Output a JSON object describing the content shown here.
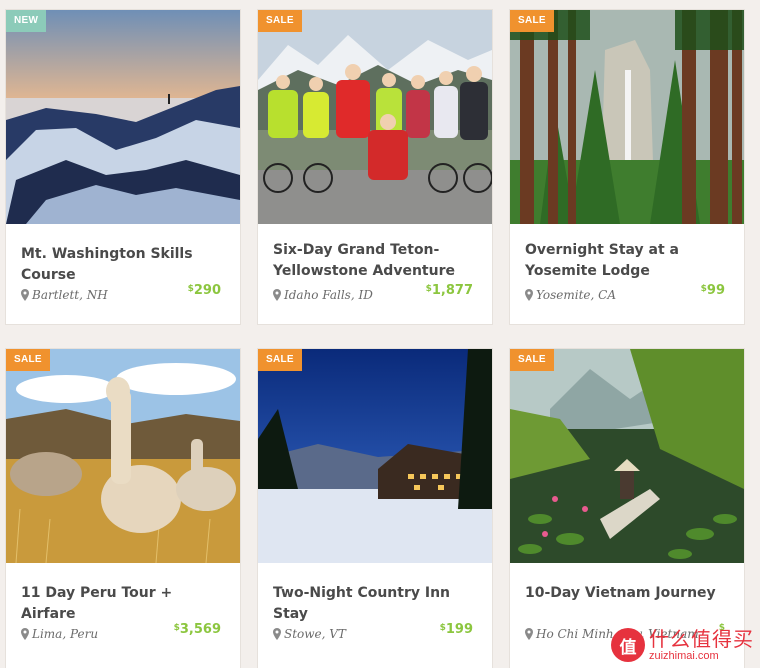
{
  "cards": [
    {
      "badge": "NEW",
      "title": "Mt. Washington Skills Course",
      "location": "Bartlett, NH",
      "currency": "$",
      "price": "290"
    },
    {
      "badge": "SALE",
      "title": "Six-Day Grand Teton-Yellowstone Adventure",
      "location": "Idaho Falls, ID",
      "currency": "$",
      "price": "1,877"
    },
    {
      "badge": "SALE",
      "title": "Overnight Stay at a Yosemite Lodge",
      "location": "Yosemite, CA",
      "currency": "$",
      "price": "99"
    },
    {
      "badge": "SALE",
      "title": "11 Day Peru Tour + Airfare",
      "location": "Lima, Peru",
      "currency": "$",
      "price": "3,569"
    },
    {
      "badge": "SALE",
      "title": "Two-Night Country Inn Stay",
      "location": "Stowe, VT",
      "currency": "$",
      "price": "199"
    },
    {
      "badge": "SALE",
      "title": "10-Day Vietnam Journey",
      "location": "Ho Chi Minh City, Vietnam",
      "currency": "$",
      "price": ""
    }
  ],
  "watermark": {
    "logo_char": "值",
    "text_cn": "什么值得买",
    "text_en": "zuizhimai.com"
  },
  "colors": {
    "badge_new": "#8ccbb9",
    "badge_sale": "#f0922e",
    "price": "#8cc63f",
    "title": "#4a4a4a"
  },
  "icons": {
    "location": "map-pin-icon"
  }
}
